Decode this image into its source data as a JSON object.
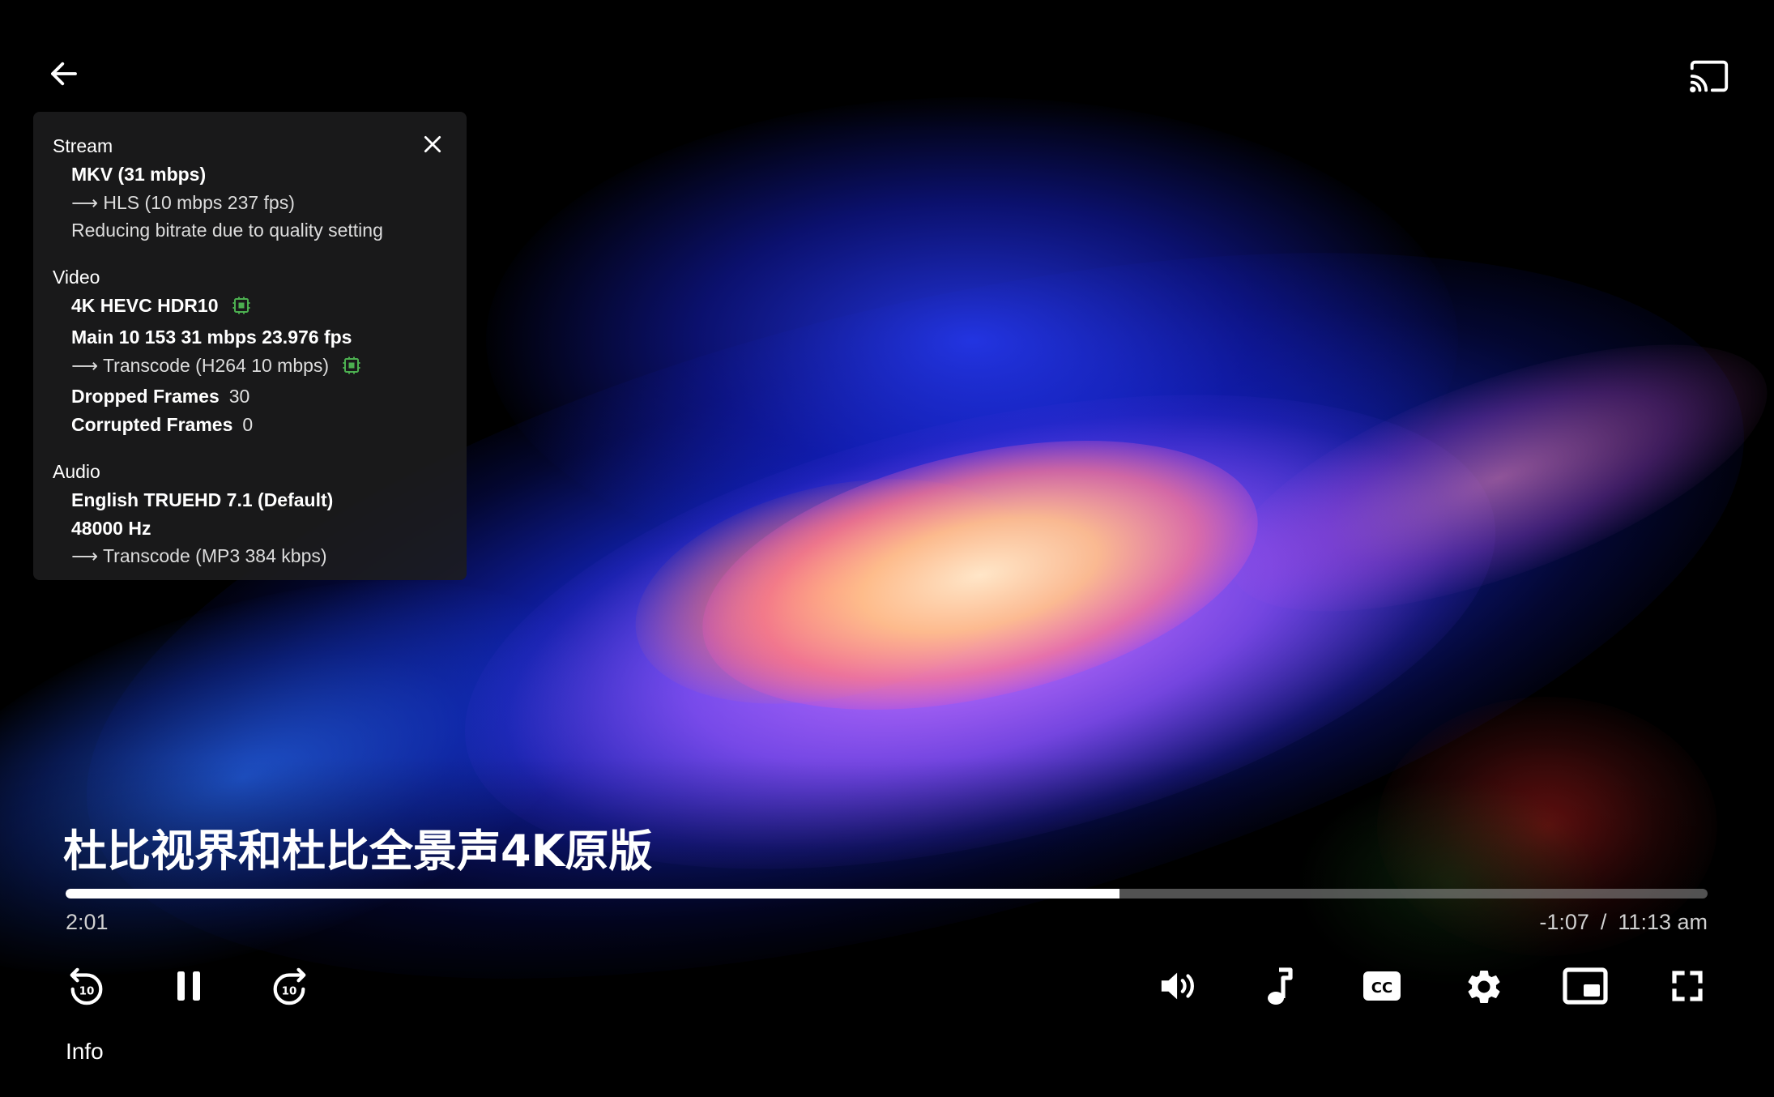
{
  "player": {
    "title": "杜比视界和杜比全景声4K原版",
    "elapsed": "2:01",
    "remaining": "-1:07",
    "separator": "/",
    "clock": "11:13 am",
    "progress_percent": 64.2,
    "info_label": "Info"
  },
  "info_panel": {
    "stream": {
      "title": "Stream",
      "container": "MKV (31 mbps)",
      "output": "HLS (10 mbps 237 fps)",
      "note": "Reducing bitrate due to quality setting"
    },
    "video": {
      "title": "Video",
      "codec": "4K HEVC HDR10",
      "profile": "Main 10 153 31 mbps 23.976 fps",
      "transcode": "Transcode (H264 10 mbps)",
      "dropped_label": "Dropped Frames",
      "dropped_value": "30",
      "corrupted_label": "Corrupted Frames",
      "corrupted_value": "0"
    },
    "audio": {
      "title": "Audio",
      "track": "English TRUEHD 7.1 (Default)",
      "rate": "48000 Hz",
      "transcode": "Transcode (MP3 384 kbps)"
    }
  },
  "icons": {
    "back": "back-arrow-icon",
    "cast": "cast-icon",
    "close": "close-icon",
    "hardware": "hardware-accel-icon",
    "rewind": "rewind-10-icon",
    "pause": "pause-icon",
    "forward": "forward-10-icon",
    "volume": "volume-icon",
    "audio_track": "music-note-icon",
    "subtitles": "closed-captions-icon",
    "settings": "gear-icon",
    "pip": "picture-in-picture-icon",
    "fullscreen": "fullscreen-icon"
  },
  "colors": {
    "hw_badge": "#4caf50",
    "panel_bg": "#1c1c1e",
    "progress_fill": "#ffffff",
    "progress_track": "#969696"
  }
}
